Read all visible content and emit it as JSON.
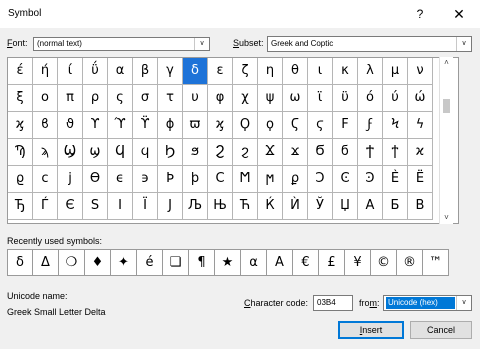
{
  "window": {
    "title": "Symbol",
    "help_label": "?",
    "close_label": "✕"
  },
  "font": {
    "label_prefix": "",
    "label_mnemonic": "F",
    "label_rest": "ont:",
    "value": "(normal text)"
  },
  "subset": {
    "label_prefix": "",
    "label_mnemonic": "S",
    "label_rest": "ubset:",
    "value": "Greek and Coptic"
  },
  "symbols": {
    "rows": [
      [
        "έ",
        "ή",
        "ί",
        "ΰ",
        "α",
        "β",
        "γ",
        "δ",
        "ε",
        "ζ",
        "η",
        "θ",
        "ι",
        "κ",
        "λ",
        "μ",
        "ν"
      ],
      [
        "ξ",
        "ο",
        "π",
        "ρ",
        "ς",
        "σ",
        "τ",
        "υ",
        "φ",
        "χ",
        "ψ",
        "ω",
        "ϊ",
        "ϋ",
        "ό",
        "ύ",
        "ώ"
      ],
      [
        "ϗ",
        "ϐ",
        "ϑ",
        "ϒ",
        "ϓ",
        "ϔ",
        "ϕ",
        "ϖ",
        "ϗ",
        "Ϙ",
        "ϙ",
        "Ϛ",
        "ϛ",
        "Ϝ",
        "ϝ",
        "Ϟ",
        "ϟ"
      ],
      [
        "Ϡ",
        "ϡ",
        "Ϣ",
        "ϣ",
        "Ϥ",
        "ϥ",
        "Ϧ",
        "ϧ",
        "Ϩ",
        "ϩ",
        "Ϫ",
        "ϫ",
        "Ϭ",
        "ϭ",
        "Ϯ",
        "ϯ",
        "ϰ"
      ],
      [
        "ϱ",
        "ϲ",
        "ϳ",
        "ϴ",
        "ϵ",
        "϶",
        "Ϸ",
        "ϸ",
        "Ϲ",
        "Ϻ",
        "ϻ",
        "ϼ",
        "Ͻ",
        "Ͼ",
        "Ͽ",
        "Ѐ",
        "Ё"
      ],
      [
        "Ђ",
        "Ѓ",
        "Є",
        "Ѕ",
        "І",
        "Ї",
        "Ј",
        "Љ",
        "Њ",
        "Ћ",
        "Ќ",
        "Ѝ",
        "Ў",
        "Џ",
        "А",
        "Б",
        "В"
      ]
    ],
    "selected_row": 0,
    "selected_col": 7
  },
  "recent": {
    "label": "Recently used symbols:",
    "symbols": [
      "δ",
      "Δ",
      "❍",
      "♦",
      "✦",
      "é",
      "❏",
      "¶",
      "★",
      "α",
      "A",
      "€",
      "£",
      "¥",
      "©",
      "®",
      "™"
    ]
  },
  "unicode": {
    "name_label": "Unicode name:",
    "name_value": "Greek Small Letter Delta",
    "code_label_mnemonic": "C",
    "code_label_rest": "haracter code:",
    "code_value": "03B4",
    "from_label_prefix": "fro",
    "from_label_mnemonic": "m",
    "from_label_rest": ":",
    "from_value": "Unicode (hex)"
  },
  "buttons": {
    "insert_label_mnemonic": "I",
    "insert_label_rest": "nsert",
    "cancel_label": "Cancel"
  },
  "colors": {
    "selection": "#1e73d8",
    "default_button_border": "#0078d7"
  }
}
